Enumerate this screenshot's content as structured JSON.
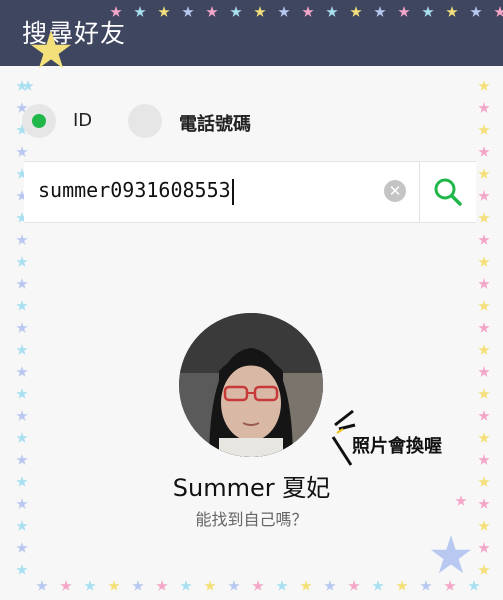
{
  "header": {
    "title": "搜尋好友"
  },
  "search_type": {
    "selected": "ID",
    "options": [
      {
        "label": "ID",
        "selected": true
      },
      {
        "label": "電話號碼",
        "selected": false
      }
    ]
  },
  "search": {
    "value": "summer0931608553",
    "clear_icon": "clear-circle-icon",
    "search_icon": "magnifier-icon"
  },
  "profile": {
    "name": "Summer 夏妃",
    "subtitle": "能找到自己嗎？"
  },
  "annotation": {
    "text": "照片會換喔"
  },
  "colors": {
    "header_bg": "#3f4660",
    "accent": "#1fb74a",
    "star_palette": [
      "#f4a6c8",
      "#a9dff0",
      "#f4e07a",
      "#b8c8f0"
    ]
  }
}
